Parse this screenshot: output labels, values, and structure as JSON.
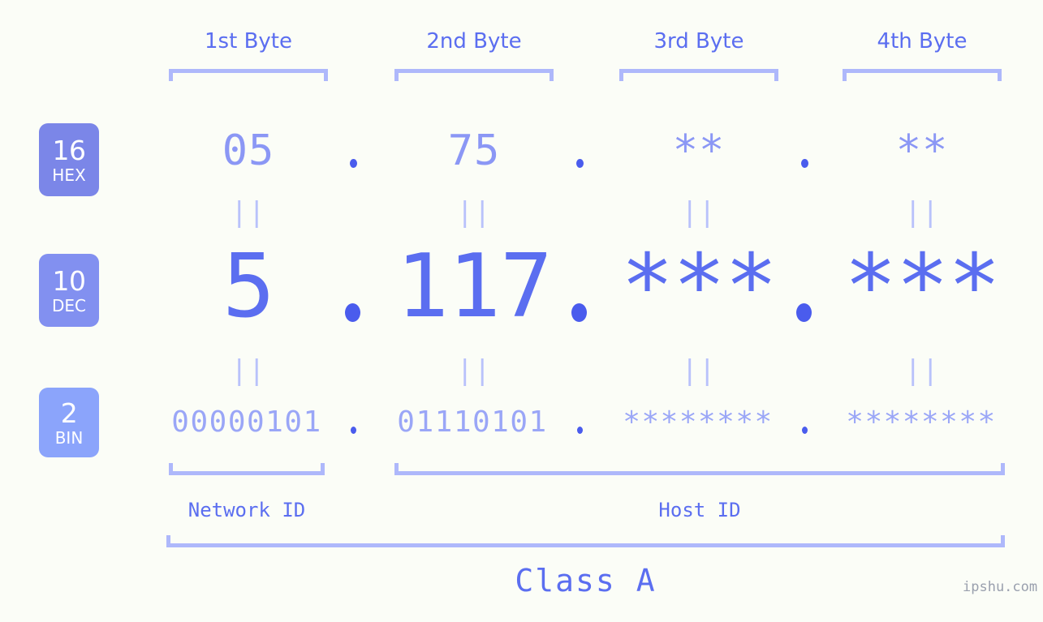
{
  "background_color": "#fbfdf7",
  "accent_color": "#5b6ef0",
  "bracket_color": "#aeb8fb",
  "byte_headers": [
    {
      "label": "1st Byte"
    },
    {
      "label": "2nd Byte"
    },
    {
      "label": "3rd Byte"
    },
    {
      "label": "4th Byte"
    }
  ],
  "rows": [
    {
      "badge_number": "16",
      "badge_name": "HEX",
      "badge_color": "#7b86e8",
      "values": [
        "05",
        "75",
        "**",
        "**"
      ]
    },
    {
      "badge_number": "10",
      "badge_name": "DEC",
      "badge_color": "#8290f0",
      "values": [
        "5",
        "117",
        "***",
        "***"
      ]
    },
    {
      "badge_number": "2",
      "badge_name": "BIN",
      "badge_color": "#8ba4fb",
      "values": [
        "00000101",
        "01110101",
        "********",
        "********"
      ]
    }
  ],
  "separator": ".",
  "equals_marker": "||",
  "id_sections": [
    {
      "label": "Network ID"
    },
    {
      "label": "Host ID"
    }
  ],
  "class_label": "Class A",
  "watermark": "ipshu.com"
}
